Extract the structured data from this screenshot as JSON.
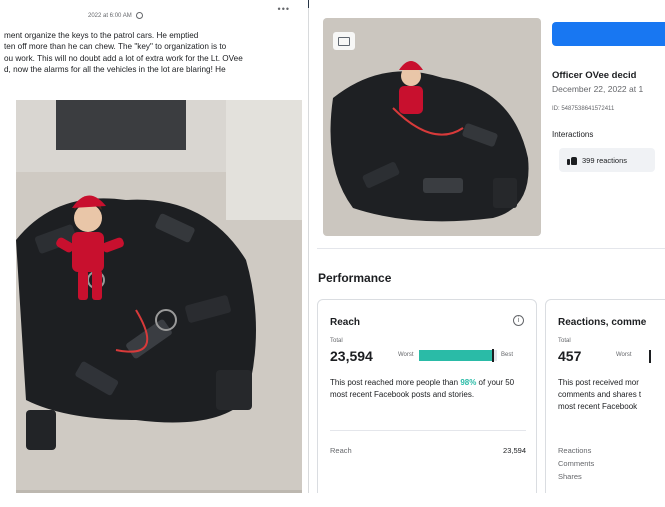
{
  "post": {
    "timestamp": "2022 at 6:00 AM",
    "text_lines": [
      "ment organize the keys to the patrol cars. He emptied",
      "ten off more than he can chew. The \"key\" to organization is to",
      "ou work. This will no doubt add a lot of extra work for the Lt. OVee",
      "d, now the alarms for all the vehicles in the lot are blaring! He"
    ]
  },
  "insights": {
    "post_title": "Officer OVee decid",
    "post_date": "December 22, 2022 at 1",
    "post_id": "ID: 5487538641572411",
    "interactions_label": "Interactions",
    "reactions_chip": "399 reactions",
    "performance_title": "Performance",
    "colors": {
      "accent_blue": "#1877f2",
      "bar_teal": "#2abba7"
    },
    "reach_card": {
      "title": "Reach",
      "total_label": "Total",
      "total_value": "23,594",
      "worst_label": "Worst",
      "best_label": "Best",
      "bar_fraction": 0.95,
      "desc_prefix": "This post reached more people than ",
      "desc_percent": "98%",
      "desc_suffix": " of your 50 most recent Facebook posts and stories.",
      "metric_label": "Reach",
      "metric_value": "23,594"
    },
    "reactions_card": {
      "title": "Reactions, comme",
      "total_label": "Total",
      "total_value": "457",
      "worst_label": "Worst",
      "desc_lines": [
        "This post received mor",
        "comments and shares t",
        "most recent Facebook"
      ],
      "list": [
        "Reactions",
        "Comments",
        "Shares"
      ]
    }
  }
}
